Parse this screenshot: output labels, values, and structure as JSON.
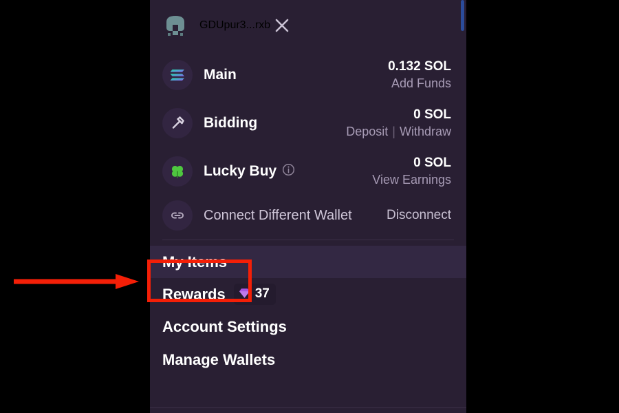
{
  "panel": {
    "header": {
      "avatar_icon": "pixel-avatar-icon",
      "wallet_name": "GDUpur3...rxb",
      "close_icon": "close-icon"
    },
    "balances": [
      {
        "icon": "solana-logo-icon",
        "label": "Main",
        "amount": "0.132 SOL",
        "actions": [
          {
            "label": "Add Funds"
          }
        ]
      },
      {
        "icon": "gavel-icon",
        "label": "Bidding",
        "amount": "0 SOL",
        "actions": [
          {
            "label": "Deposit"
          },
          {
            "label": "Withdraw"
          }
        ],
        "separator": "|"
      },
      {
        "icon": "clover-icon",
        "label": "Lucky Buy",
        "info_icon": "info-icon",
        "amount": "0 SOL",
        "actions": [
          {
            "label": "View Earnings"
          }
        ]
      }
    ],
    "connect_row": {
      "icon": "link-icon",
      "label": "Connect Different Wallet",
      "disconnect_label": "Disconnect"
    },
    "menu": [
      {
        "label": "My Items",
        "highlighted": true
      },
      {
        "label": "Rewards",
        "badge_icon": "gem-icon",
        "badge_count": "37"
      },
      {
        "label": "Account Settings"
      },
      {
        "label": "Manage Wallets"
      }
    ],
    "scrollbar": {
      "name": "vertical-scrollbar"
    }
  },
  "annotations": {
    "highlight_box": {
      "name": "my-items-highlight-box",
      "color": "#f41f07"
    },
    "arrow": {
      "name": "pointer-arrow",
      "color": "#f41f07",
      "direction": "right"
    }
  },
  "colors": {
    "panel_background": "#291f33",
    "row_highlight": "#332843",
    "icon_circle": "#322541",
    "text_primary": "#ffffff",
    "text_muted": "#a79bb5",
    "accent_red": "#f41f07",
    "scrollbar_blue": "#2b4c9b",
    "gem_purple": "#a855e0",
    "clover_green": "#4ec73f"
  }
}
